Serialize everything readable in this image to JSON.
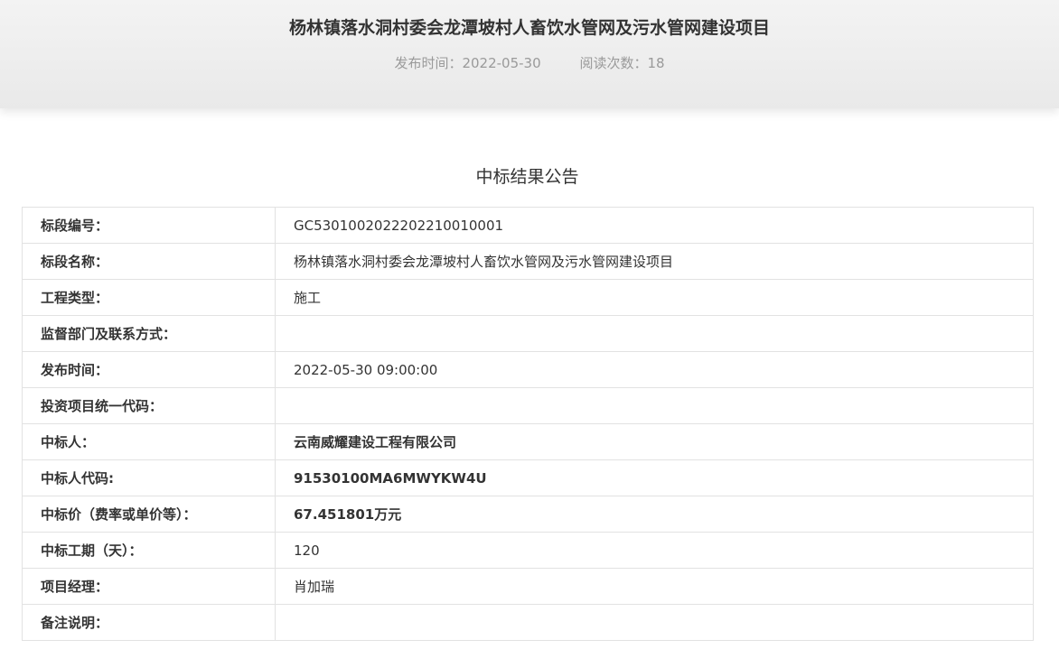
{
  "article": {
    "title": "杨林镇落水洞村委会龙潭坡村人畜饮水管网及污水管网建设项目",
    "publish_time": "发布时间：2022-05-30",
    "read_count": "阅读次数：18"
  },
  "notice": {
    "heading": "中标结果公告",
    "rows": [
      {
        "label": "标段编号：",
        "value": "GC5301002022202210010001"
      },
      {
        "label": "标段名称：",
        "value": "杨林镇落水洞村委会龙潭坡村人畜饮水管网及污水管网建设项目"
      },
      {
        "label": "工程类型：",
        "value": "施工"
      },
      {
        "label": "监督部门及联系方式：",
        "value": ""
      },
      {
        "label": "发布时间：",
        "value": "2022-05-30 09:00:00"
      },
      {
        "label": "投资项目统一代码：",
        "value": ""
      },
      {
        "label": "中标人：",
        "value": "云南威耀建设工程有限公司"
      },
      {
        "label": "中标人代码:",
        "value": "91530100MA6MWYKW4U"
      },
      {
        "label": "中标价（费率或单价等）：",
        "value": "67.451801万元"
      },
      {
        "label": "中标工期（天）：",
        "value": "120"
      },
      {
        "label": "项目经理：",
        "value": "肖加瑞"
      },
      {
        "label": "备注说明：",
        "value": ""
      }
    ]
  }
}
